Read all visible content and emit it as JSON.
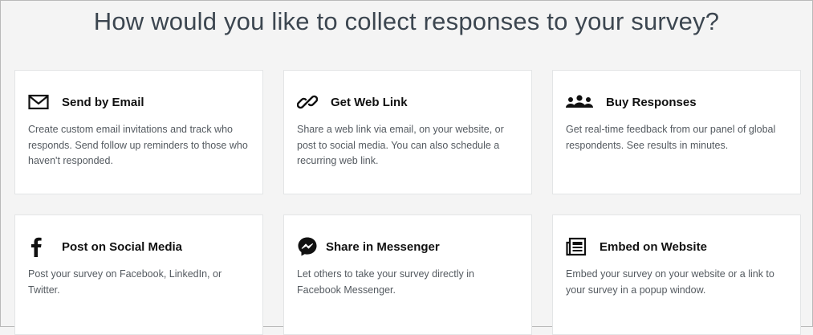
{
  "page": {
    "title": "How would you like to collect responses to your survey?"
  },
  "options": [
    {
      "icon": "envelope-icon",
      "title": "Send by Email",
      "description": "Create custom email invitations and track who responds. Send follow up reminders to those who haven't responded."
    },
    {
      "icon": "link-icon",
      "title": "Get Web Link",
      "description": "Share a web link via email, on your website, or post to social media. You can also schedule a recurring web link."
    },
    {
      "icon": "people-icon",
      "title": "Buy Responses",
      "description": "Get real-time feedback from our panel of global respondents. See results in minutes."
    },
    {
      "icon": "facebook-icon",
      "title": "Post on Social Media",
      "description": "Post your survey on Facebook, LinkedIn, or Twitter."
    },
    {
      "icon": "messenger-icon",
      "title": "Share in Messenger",
      "description": "Let others to take your survey directly in Facebook Messenger."
    },
    {
      "icon": "embed-icon",
      "title": "Embed on Website",
      "description": "Embed your survey on your website or a link to your survey in a popup window."
    }
  ],
  "colors": {
    "background": "#f4f4f4",
    "card": "#ffffff",
    "title_text": "#3c4650",
    "body_text": "#545a60"
  }
}
